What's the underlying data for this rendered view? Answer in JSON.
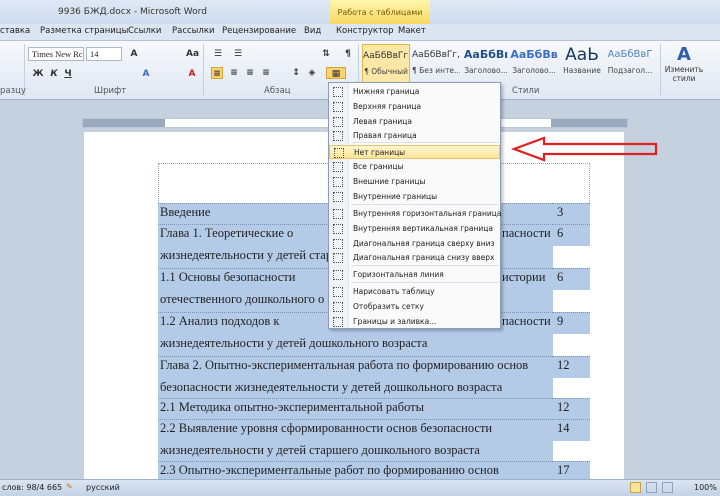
{
  "window": {
    "title": "9936 БЖД.docx - Microsoft Word",
    "context_tab": "Работа с таблицами"
  },
  "tabs": [
    "ставка",
    "Разметка страницы",
    "Ссылки",
    "Рассылки",
    "Рецензирование",
    "Вид",
    "Конструктор",
    "Макет"
  ],
  "ribbon": {
    "font_name": "Times New Rc",
    "font_size": "14",
    "groups": {
      "clipboard": "разцу",
      "font": "Шрифт",
      "paragraph": "Абзац",
      "styles": "Стили"
    },
    "styles": [
      {
        "preview": "АаБбВвГг,",
        "name": "¶ Обычный"
      },
      {
        "preview": "АаБбВвГг,",
        "name": "¶ Без инте..."
      },
      {
        "preview": "АаБбВı",
        "name": "Заголово..."
      },
      {
        "preview": "АаБбВв",
        "name": "Заголово..."
      },
      {
        "preview": "АаЬ",
        "name": "Название"
      },
      {
        "preview": "АаБбВвГ",
        "name": "Подзагол..."
      }
    ],
    "change_styles": "Изменить стили"
  },
  "border_menu": {
    "items": [
      {
        "label": "Нижняя граница",
        "icon": "bottom-border-icon"
      },
      {
        "label": "Верхняя граница",
        "icon": "top-border-icon"
      },
      {
        "label": "Левая граница",
        "icon": "left-border-icon"
      },
      {
        "label": "Правая граница",
        "icon": "right-border-icon"
      },
      {
        "label": "Нет границы",
        "icon": "no-border-icon",
        "highlighted": true
      },
      {
        "label": "Все границы",
        "icon": "all-borders-icon"
      },
      {
        "label": "Внешние границы",
        "icon": "outside-borders-icon"
      },
      {
        "label": "Внутренние границы",
        "icon": "inside-borders-icon"
      },
      {
        "label": "Внутренняя горизонтальная граница",
        "icon": "inside-horizontal-border-icon"
      },
      {
        "label": "Внутренняя вертикальная граница",
        "icon": "inside-vertical-border-icon"
      },
      {
        "label": "Диагональная граница сверху вниз",
        "icon": "diagonal-down-border-icon"
      },
      {
        "label": "Диагональная граница снизу вверх",
        "icon": "diagonal-up-border-icon"
      },
      {
        "label": "Горизонтальная линия",
        "icon": "horizontal-line-icon"
      },
      {
        "label": "Нарисовать таблицу",
        "icon": "draw-table-icon"
      },
      {
        "label": "Отобразить сетку",
        "icon": "view-gridlines-icon"
      },
      {
        "label": "Границы и заливка...",
        "icon": "borders-shading-icon"
      }
    ]
  },
  "toc_rows": [
    {
      "lines": [
        "Введение"
      ],
      "page": "3"
    },
    {
      "lines": [
        "Глава    1.    Теоретические    о",
        "жизнедеятельности у детей стар"
      ],
      "page": "6",
      "tail": "пасности"
    },
    {
      "lines": [
        "1.1    Основы    безопасности",
        "отечественного дошкольного о"
      ],
      "page": "6",
      "tail": "истории"
    },
    {
      "lines": [
        "1.2    Анализ    подходов    к",
        "жизнедеятельности у детей дошкольного возраста"
      ],
      "page": "9",
      "tail": "пасности"
    },
    {
      "lines": [
        "Глава 2. Опытно-экспериментальная работа по формированию основ",
        "безопасности жизнедеятельности у детей дошкольного возраста"
      ],
      "page": "12"
    },
    {
      "lines": [
        "2.1 Методика опытно-экспериментальной работы"
      ],
      "page": "12"
    },
    {
      "lines": [
        "2.2    Выявление    уровня    сформированности    основ    безопасности",
        "жизнедеятельности у детей старшего дошкольного возраста"
      ],
      "page": "14"
    },
    {
      "lines": [
        "2.3    Опытно-экспериментальные    работ    по    формированию    основ"
      ],
      "page": "17"
    }
  ],
  "status": {
    "words": "слов: 98/4 665",
    "language": "русский",
    "zoom": "100%"
  },
  "colors": {
    "selection": "#b4cbe8",
    "arrow": "#e02020",
    "highlight": "#fde59a"
  }
}
